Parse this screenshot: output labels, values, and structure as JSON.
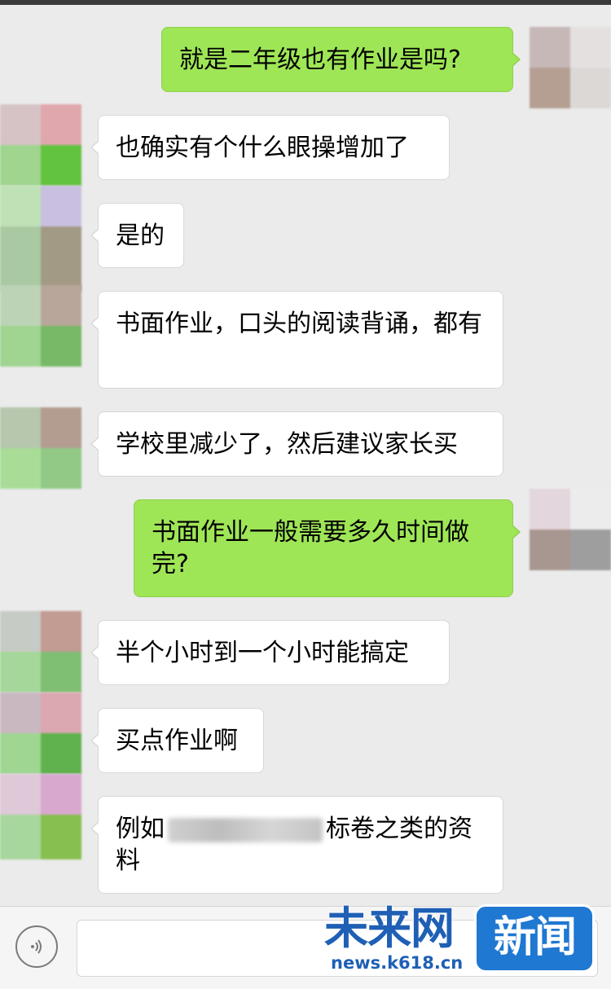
{
  "colors": {
    "background": "#ebebeb",
    "sent_bubble": "#9fe657",
    "received_bubble": "#ffffff",
    "watermark_blue": "#1f5fb5"
  },
  "messages": [
    {
      "side": "right",
      "text": "就是二年级也有作业是吗?"
    },
    {
      "side": "left",
      "text": "也确实有个什么眼操增加了"
    },
    {
      "side": "left",
      "text": "是的"
    },
    {
      "side": "left",
      "text": "书面作业，口头的阅读背诵，都有"
    },
    {
      "side": "left",
      "text": "学校里减少了，然后建议家长买"
    },
    {
      "side": "right",
      "text": "书面作业一般需要多久时间做完?"
    },
    {
      "side": "left",
      "text": "半个小时到一个小时能搞定"
    },
    {
      "side": "left",
      "text": "买点作业啊"
    },
    {
      "side": "left",
      "text_before": "例如",
      "text_after": "标卷之类的资料"
    }
  ],
  "input_bar": {
    "voice_icon": "voice-icon"
  },
  "watermark": {
    "brand": "未来网",
    "box": "新闻",
    "url": "news.k618.cn"
  }
}
